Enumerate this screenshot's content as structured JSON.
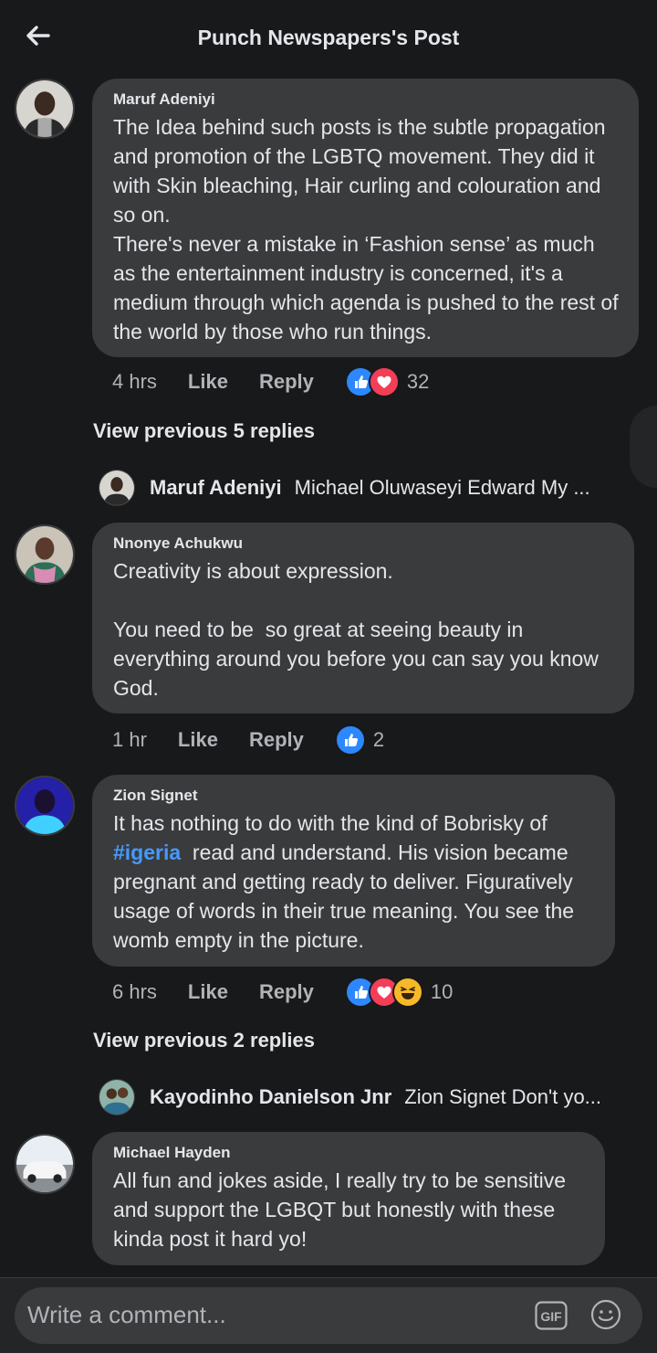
{
  "header": {
    "title": "Punch Newspapers's Post"
  },
  "comments": [
    {
      "author": "Maruf Adeniyi",
      "text": "The Idea behind such posts is the subtle propagation and promotion of the LGBTQ movement. They did it with Skin bleaching, Hair curling and colouration and so on.\nThere's never a mistake in ‘Fashion sense’ as much as the entertainment industry is concerned, it's a medium through which agenda is pushed to the rest of the world by those who run things.",
      "time": "4 hrs",
      "like": "Like",
      "reply": "Reply",
      "reaction_count": "32",
      "reactions": [
        "like-icon",
        "love-icon"
      ],
      "view_previous": "View previous 5 replies",
      "latest_reply": {
        "name": "Maruf Adeniyi",
        "text": "Michael Oluwaseyi Edward My ..."
      }
    },
    {
      "author": "Nnonye Achukwu",
      "text": "Creativity is about expression.\n\nYou need to be  so great at seeing beauty in everything around you before you can say you know God.",
      "time": "1 hr",
      "like": "Like",
      "reply": "Reply",
      "reaction_count": "2",
      "reactions": [
        "like-icon"
      ]
    },
    {
      "author": "Zion Signet",
      "text_before_tag": "It has nothing to do with the kind of Bobrisky of ",
      "hashtag": "#igeria",
      "text_after_tag": "  read and understand. His vision became pregnant and getting ready to deliver. Figuratively usage of words in their true meaning. You see the womb empty in the picture.",
      "time": "6 hrs",
      "like": "Like",
      "reply": "Reply",
      "reaction_count": "10",
      "reactions": [
        "like-icon",
        "love-icon",
        "haha-icon"
      ],
      "view_previous": "View previous 2 replies",
      "latest_reply": {
        "name": "Kayodinho Danielson Jnr",
        "text": "Zion Signet Don't yo..."
      }
    },
    {
      "author": "Michael Hayden",
      "text": "All fun and jokes aside, I really try to be sensitive and support the LGBQT but honestly with these kinda post it hard yo!"
    }
  ],
  "composer": {
    "placeholder": "Write a comment...",
    "gif_label": "GIF"
  },
  "colors": {
    "background": "#18191a",
    "bubble": "#3a3b3c",
    "hashtag": "#4599ff",
    "like_blue": "#2d88ff",
    "love_red": "#f33e58",
    "haha_yellow": "#f7b928"
  }
}
